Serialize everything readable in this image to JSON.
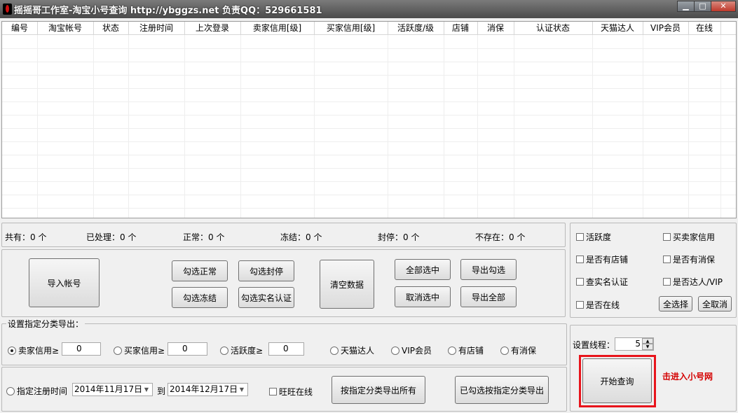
{
  "window": {
    "title": "摇摇哥工作室-淘宝小号查询    http://ybggzs.net  负责QQ：529661581",
    "minimize": "▁",
    "maximize": "□",
    "close": "✕"
  },
  "grid": {
    "columns": [
      "编号",
      "淘宝帐号",
      "状态",
      "注册时间",
      "上次登录",
      "卖家信用[级]",
      "买家信用[级]",
      "活跃度/级",
      "店铺",
      "消保",
      "认证状态",
      "天猫达人",
      "VIP会员",
      "在线"
    ]
  },
  "stats": {
    "total": "共有：0 个",
    "processed": "已处理：0 个",
    "normal": "正常：0 个",
    "frozen": "冻结：0 个",
    "banned": "封停：0 个",
    "missing": "不存在：0 个"
  },
  "filters": {
    "items": [
      "活跃度",
      "买卖家信用",
      "是否有店铺",
      "是否有消保",
      "查实名认证",
      "是否达人/VIP",
      "是否在线"
    ],
    "select_all": "全选择",
    "cancel_all": "全取消"
  },
  "actions": {
    "import": "导入帐号",
    "check_normal": "勾选正常",
    "check_banned": "勾选封停",
    "check_frozen": "勾选冻结",
    "check_realname": "勾选实名认证",
    "clear": "清空数据",
    "select_all": "全部选中",
    "export_checked": "导出勾选",
    "deselect": "取消选中",
    "export_all": "导出全部"
  },
  "category_export": {
    "group_title": "设置指定分类导出：",
    "seller_credit": {
      "label": "卖家信用≥",
      "value": "0",
      "selected": true
    },
    "buyer_credit": {
      "label": "买家信用≥",
      "value": "0"
    },
    "activity": {
      "label": "活跃度≥",
      "value": "0"
    },
    "tmall": "天猫达人",
    "vip": "VIP会员",
    "shop": "有店铺",
    "consumer_protect": "有消保",
    "reg_time": "指定注册时间",
    "date_from": "2014年11月17日",
    "to": "到",
    "date_to": "2014年12月17日",
    "wangwang_online": "旺旺在线",
    "export_by_category": "按指定分类导出所有",
    "export_checked_by_category": "已勾选按指定分类导出"
  },
  "run": {
    "threads_label": "设置线程：",
    "threads_value": "5",
    "start": "开始查询",
    "link_text": "击进入小号网"
  },
  "colors": {
    "highlight": "#e8141b",
    "link": "#d40000"
  }
}
